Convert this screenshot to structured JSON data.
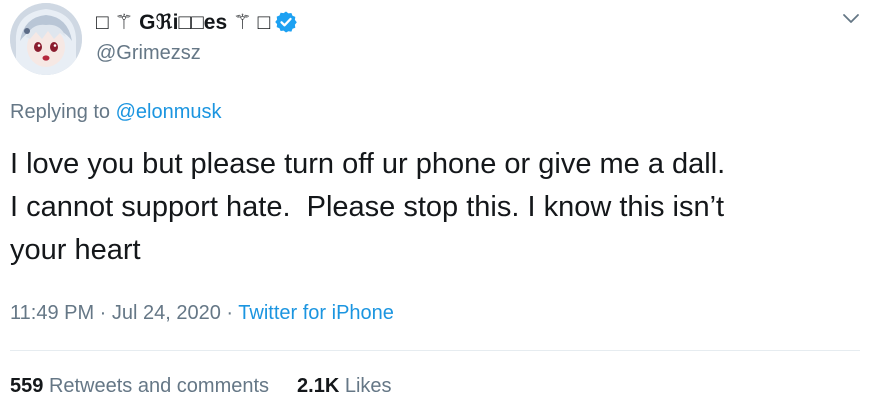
{
  "tweet": {
    "author": {
      "display_name": "□ ⚚ Gℜi□□es ⚚ □",
      "handle": "@Grimezsz",
      "verified": true
    },
    "replying_to": {
      "prefix": "Replying to",
      "mention": "@elonmusk"
    },
    "text": "I love you but please turn off ur phone or give me a dall.\nI cannot support hate.  Please stop this. I know this isn’t\nyour heart",
    "timestamp": "11:49 PM · Jul 24, 2020",
    "separator": " · ",
    "source": "Twitter for iPhone",
    "stats": {
      "retweets_count": "559",
      "retweets_label": "Retweets and comments",
      "likes_count": "2.1K",
      "likes_label": "Likes"
    }
  },
  "colors": {
    "primary_text": "#14171a",
    "secondary_text": "#657786",
    "link": "#1b95e0",
    "verified_badge": "#1da1f2",
    "divider": "#e6ecf0"
  },
  "icons": [
    "avatar",
    "verified-badge-icon",
    "chevron-down-icon"
  ]
}
